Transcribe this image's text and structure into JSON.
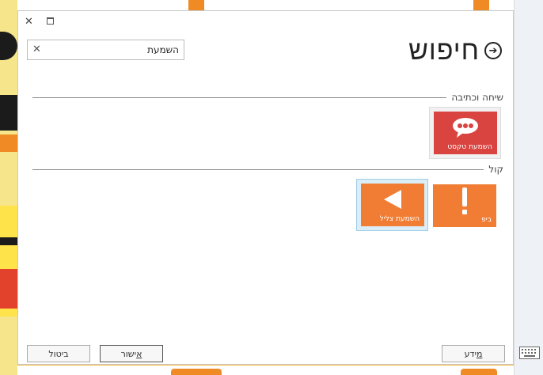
{
  "dialog": {
    "title": "חיפוש",
    "search": {
      "value": "השמעת",
      "placeholder": ""
    },
    "groups": [
      {
        "label": "שיחה וכתיבה",
        "tiles": [
          {
            "label": "השמעת טקסט",
            "icon": "speech-bubble-icon",
            "color": "#d94440"
          }
        ]
      },
      {
        "label": "קול",
        "tiles": [
          {
            "label": "ביפ",
            "icon": "exclamation-icon",
            "color": "#f07d33"
          },
          {
            "label": "השמעת צליל",
            "icon": "play-triangle-icon",
            "color": "#f07d33",
            "selected": true
          }
        ]
      }
    ],
    "buttons": {
      "cancel": "ביטול",
      "ok_first": "א",
      "ok_rest": "ישור",
      "info_first": "מ",
      "info_rest": "ידע"
    }
  }
}
